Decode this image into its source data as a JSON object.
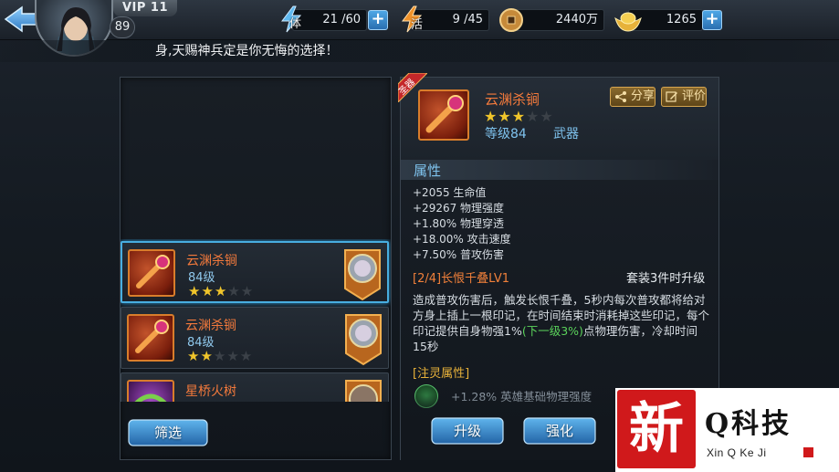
{
  "top_bar": {
    "vip_label": "VIP 11",
    "player_level": "89",
    "stamina": {
      "icon_label": "体",
      "value": "21 /60"
    },
    "vigor": {
      "icon_label": "活",
      "value": "9 /45"
    },
    "copper": {
      "value": "2440万"
    },
    "ingots": {
      "value": "1265"
    },
    "plus_symbol": "+"
  },
  "marquee_text": "身,天赐神兵定是你无悔的选择！",
  "equipment_list": {
    "items": [
      {
        "name": "云渊杀锏",
        "level": "84级",
        "stars_on": "★★★",
        "stars_off": "★★",
        "selected": true
      },
      {
        "name": "云渊杀锏",
        "level": "84级",
        "stars_on": "★★",
        "stars_off": "★★★",
        "selected": false
      },
      {
        "name": "星桥火树",
        "level": "",
        "stars_on": "",
        "stars_off": "",
        "selected": false
      }
    ],
    "filter_button": "筛选"
  },
  "detail": {
    "sacred_tag": "圣器",
    "name": "云渊杀锏",
    "stars_on": "★★★",
    "stars_off": "★★",
    "level": "等级84",
    "type": "武器",
    "share_button": "分享",
    "review_button": "评价",
    "attributes_title": "属性",
    "attributes": [
      "+2055 生命值",
      "+29267 物理强度",
      "+1.80% 物理穿透",
      "+18.00% 攻击速度",
      "+7.50% 普攻伤害"
    ],
    "set_title": "[2/4]长恨千叠LV1",
    "set_note": "套装3件时升级",
    "set_desc_part1": "造成普攻伤害后，触发长恨千叠，5秒内每次普攻都将给对方身上插上一根印记，在时间结束时消耗掉这些印记，每个印记提供自身物强1%",
    "set_desc_green": "(下一级3%)",
    "set_desc_part2": "点物理伤害，冷却时间15秒",
    "spirit_title": "[注灵属性]",
    "spirit_line": "+1.28% 英雄基础物理强度",
    "upgrade_button": "升级",
    "enhance_button": "强化"
  },
  "watermark": {
    "seal_char": "新",
    "title": "Q科技",
    "subtitle": "Xin Q Ke Ji"
  },
  "colors": {
    "item_name": "#f47a3c",
    "level_blue": "#7fc3ee",
    "star_gold": "#f0c52b",
    "green_text": "#5bd45b",
    "button_blue": "#3c8ed3",
    "selected_border": "#48aee0"
  }
}
